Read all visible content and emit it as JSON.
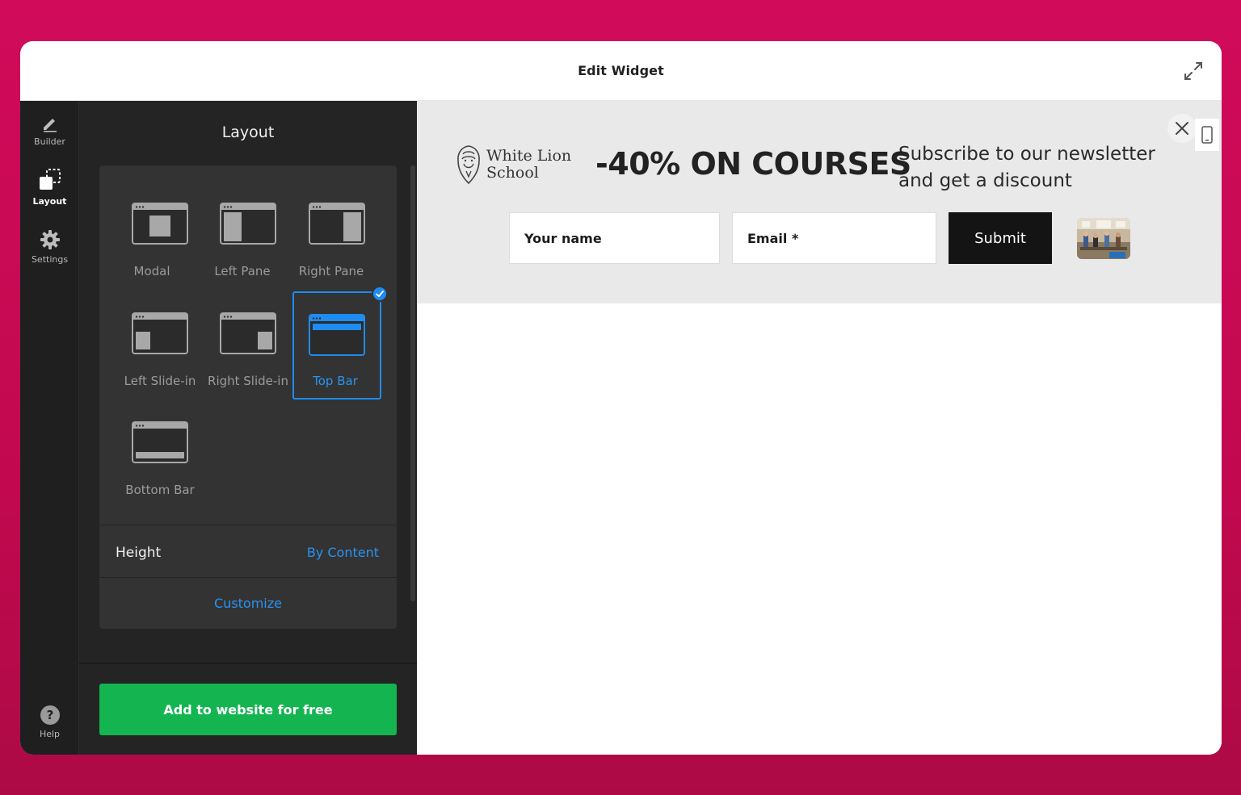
{
  "window": {
    "title": "Edit Widget"
  },
  "rail": {
    "items": [
      {
        "label": "Builder",
        "icon": "pencil-icon"
      },
      {
        "label": "Layout",
        "icon": "layout-icon",
        "active": true
      },
      {
        "label": "Settings",
        "icon": "gear-icon"
      }
    ],
    "help": {
      "label": "Help",
      "icon": "help-icon"
    }
  },
  "panel": {
    "title": "Layout",
    "options": [
      {
        "label": "Modal"
      },
      {
        "label": "Left Pane"
      },
      {
        "label": "Right Pane"
      },
      {
        "label": "Left Slide-in"
      },
      {
        "label": "Right Slide-in"
      },
      {
        "label": "Top Bar",
        "selected": true
      },
      {
        "label": "Bottom Bar"
      }
    ],
    "height": {
      "label": "Height",
      "value": "By Content"
    },
    "customize_label": "Customize",
    "add_button_label": "Add to website for free"
  },
  "preview": {
    "logo_name_line1": "White Lion",
    "logo_name_line2": "School",
    "headline": "-40% ON COURSES",
    "subtext": "Subscribe to our newsletter and get a discount",
    "name_placeholder": "Your name",
    "email_placeholder": "Email *",
    "submit_label": "Submit"
  },
  "colors": {
    "accent": "#1e8cf0",
    "cta_green": "#14b551",
    "background_magenta": "#c90a55",
    "panel_dark": "#242424"
  }
}
